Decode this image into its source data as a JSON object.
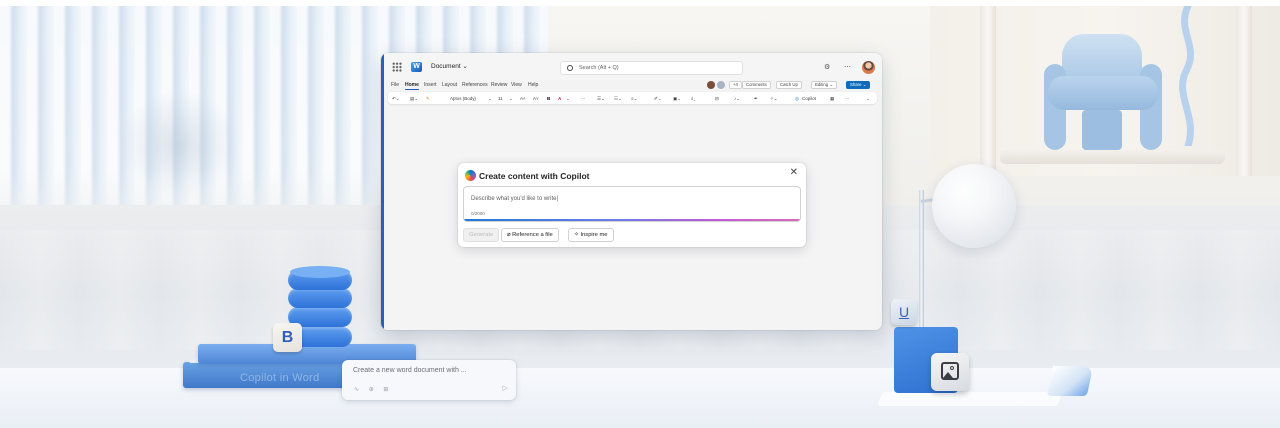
{
  "word": {
    "doc_title": "Document ⌄",
    "search_placeholder": "Search (Alt + Q)",
    "settings_glyph": "⚙",
    "more_glyph": "⋯",
    "tabs": [
      "File",
      "Home",
      "Insert",
      "Layout",
      "References",
      "Review",
      "View",
      "Help"
    ],
    "active_tab": "Home",
    "collab_count": "+4",
    "comments_label": "Comments",
    "catchup_label": "Catch Up",
    "editing_label": "Editing ⌄",
    "share_label": "Share ⌄",
    "ribbon": {
      "font_name": "Aptos (Body)",
      "font_size": "11",
      "bold": "B",
      "font_color": "A",
      "copilot_label": "Copilot"
    }
  },
  "copilot_dialog": {
    "title": "Create content with Copilot",
    "close_glyph": "✕",
    "placeholder": "Describe what you'd like to write|",
    "counter": "0/2000",
    "generate_label": "Generate",
    "reference_label": "Reference a file",
    "inspire_label": "Inspire me"
  },
  "props": {
    "book_title": "Copilot in Word",
    "b_cube_letter": "B",
    "u_cube_letter": "U",
    "prompt_card_text": "Create a new word document with ...",
    "prompt_card_icons": "∿ ⊕ ⊞",
    "prompt_send_glyph": "▷"
  },
  "colors": {
    "word_blue": "#185abd",
    "share_blue": "#0f6cbd",
    "accent_gradient_start": "#1f7ad8",
    "accent_gradient_end": "#d86ab8"
  }
}
